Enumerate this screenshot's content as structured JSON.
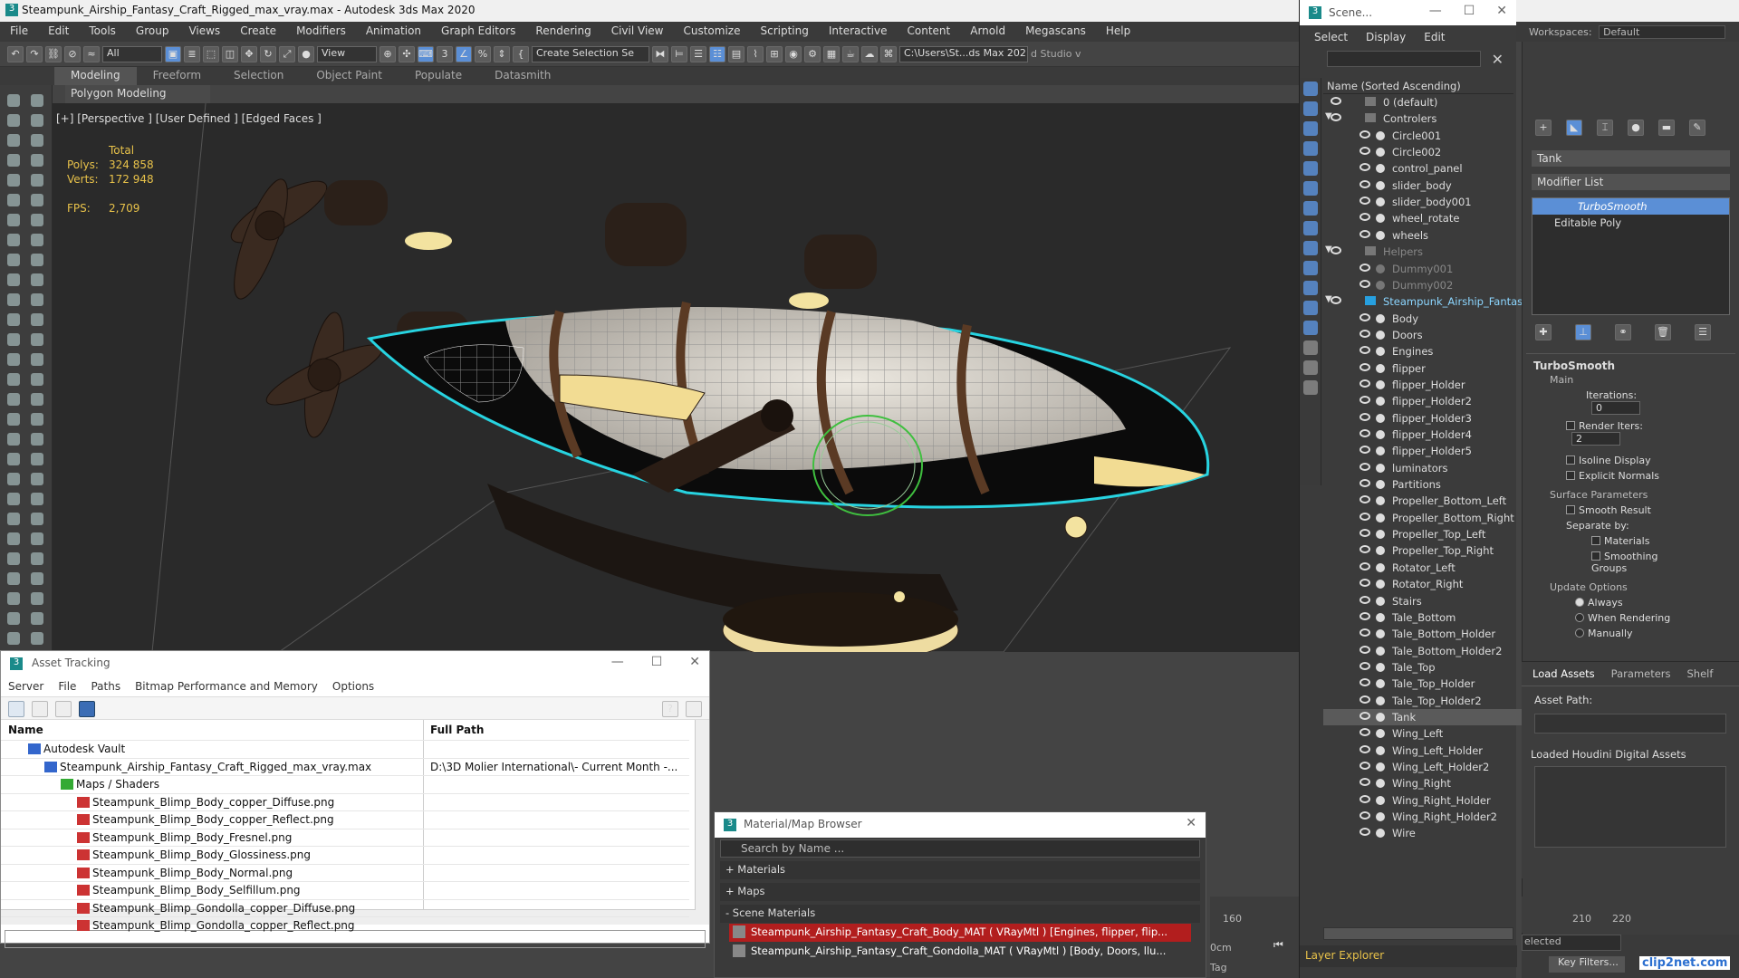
{
  "app": {
    "title": "Steampunk_Airship_Fantasy_Craft_Rigged_max_vray.max - Autodesk 3ds Max 2020",
    "workspace_label": "Workspaces:",
    "workspace_value": "Default"
  },
  "menu": [
    "File",
    "Edit",
    "Tools",
    "Group",
    "Views",
    "Create",
    "Modifiers",
    "Animation",
    "Graph Editors",
    "Rendering",
    "Civil View",
    "Customize",
    "Scripting",
    "Interactive",
    "Content",
    "Arnold",
    "Megascans",
    "Help"
  ],
  "toolbar": {
    "filter": "All",
    "view": "View",
    "selection_set": "Create Selection Se",
    "path": "C:\\Users\\St...ds Max 202",
    "studio": "d Studio v"
  },
  "ribbon": {
    "tabs": [
      "Modeling",
      "Freeform",
      "Selection",
      "Object Paint",
      "Populate",
      "Datasmith"
    ],
    "sub": "Polygon Modeling"
  },
  "viewport": {
    "label": "[+] [Perspective ] [User Defined ] [Edged Faces ]",
    "stats": {
      "total": "Total",
      "polys_label": "Polys:",
      "polys": "324 858",
      "verts_label": "Verts:",
      "verts": "172 948",
      "fps_label": "FPS:",
      "fps": "2,709"
    }
  },
  "scene_explorer": {
    "title": "Scene...",
    "menu": [
      "Select",
      "Display",
      "Edit"
    ],
    "column": "Name (Sorted Ascending)",
    "footer": "Layer Explorer",
    "rows": [
      {
        "name": "0 (default)",
        "level": 0
      },
      {
        "name": "Controlers",
        "level": 0
      },
      {
        "name": "Circle001",
        "level": 1
      },
      {
        "name": "Circle002",
        "level": 1
      },
      {
        "name": "control_panel",
        "level": 1
      },
      {
        "name": "slider_body",
        "level": 1
      },
      {
        "name": "slider_body001",
        "level": 1
      },
      {
        "name": "wheel_rotate",
        "level": 1
      },
      {
        "name": "wheels",
        "level": 1
      },
      {
        "name": "Helpers",
        "level": 0
      },
      {
        "name": "Dummy001",
        "level": 1
      },
      {
        "name": "Dummy002",
        "level": 1
      },
      {
        "name": "Steampunk_Airship_Fantas",
        "level": 0
      },
      {
        "name": "Body",
        "level": 1
      },
      {
        "name": "Doors",
        "level": 1
      },
      {
        "name": "Engines",
        "level": 1
      },
      {
        "name": "flipper",
        "level": 1
      },
      {
        "name": "flipper_Holder",
        "level": 1
      },
      {
        "name": "flipper_Holder2",
        "level": 1
      },
      {
        "name": "flipper_Holder3",
        "level": 1
      },
      {
        "name": "flipper_Holder4",
        "level": 1
      },
      {
        "name": "flipper_Holder5",
        "level": 1
      },
      {
        "name": "luminators",
        "level": 1
      },
      {
        "name": "Partitions",
        "level": 1
      },
      {
        "name": "Propeller_Bottom_Left",
        "level": 1
      },
      {
        "name": "Propeller_Bottom_Right",
        "level": 1
      },
      {
        "name": "Propeller_Top_Left",
        "level": 1
      },
      {
        "name": "Propeller_Top_Right",
        "level": 1
      },
      {
        "name": "Rotator_Left",
        "level": 1
      },
      {
        "name": "Rotator_Right",
        "level": 1
      },
      {
        "name": "Stairs",
        "level": 1
      },
      {
        "name": "Tale_Bottom",
        "level": 1
      },
      {
        "name": "Tale_Bottom_Holder",
        "level": 1
      },
      {
        "name": "Tale_Bottom_Holder2",
        "level": 1
      },
      {
        "name": "Tale_Top",
        "level": 1
      },
      {
        "name": "Tale_Top_Holder",
        "level": 1
      },
      {
        "name": "Tale_Top_Holder2",
        "level": 1
      },
      {
        "name": "Tank",
        "level": 1
      },
      {
        "name": "Wing_Left",
        "level": 1
      },
      {
        "name": "Wing_Left_Holder",
        "level": 1
      },
      {
        "name": "Wing_Left_Holder2",
        "level": 1
      },
      {
        "name": "Wing_Right",
        "level": 1
      },
      {
        "name": "Wing_Right_Holder",
        "level": 1
      },
      {
        "name": "Wing_Right_Holder2",
        "level": 1
      },
      {
        "name": "Wire",
        "level": 1
      }
    ]
  },
  "command_panel": {
    "object_name": "Tank",
    "modifier_list": "Modifier List",
    "stack": [
      "TurboSmooth",
      "Editable Poly"
    ],
    "turbosmooth": {
      "title": "TurboSmooth",
      "main": "Main",
      "iterations_label": "Iterations:",
      "iterations": "0",
      "render_iters_label": "Render Iters:",
      "render_iters": "2",
      "isoline": "Isoline Display",
      "explicit": "Explicit Normals",
      "surface": "Surface Parameters",
      "smooth_result": "Smooth Result",
      "separate": "Separate by:",
      "materials": "Materials",
      "smoothing": "Smoothing Groups",
      "update": "Update Options",
      "always": "Always",
      "when_rendering": "When Rendering",
      "manually": "Manually"
    },
    "tabs": [
      "Load Assets",
      "Parameters",
      "Shelf"
    ],
    "asset_path": "Asset Path:",
    "loaded": "Loaded Houdini Digital Assets"
  },
  "asset_tracking": {
    "title": "Asset Tracking",
    "menu": [
      "Server",
      "File",
      "Paths",
      "Bitmap Performance and Memory",
      "Options"
    ],
    "col_name": "Name",
    "col_path": "Full Path",
    "rows": [
      {
        "name": "Autodesk Vault",
        "path": "",
        "indent": 1
      },
      {
        "name": "Steampunk_Airship_Fantasy_Craft_Rigged_max_vray.max",
        "path": "D:\\3D Molier International\\- Current Month -...",
        "indent": 2
      },
      {
        "name": "Maps / Shaders",
        "path": "",
        "indent": 3
      },
      {
        "name": "Steampunk_Blimp_Body_copper_Diffuse.png",
        "path": "",
        "indent": 4
      },
      {
        "name": "Steampunk_Blimp_Body_copper_Reflect.png",
        "path": "",
        "indent": 4
      },
      {
        "name": "Steampunk_Blimp_Body_Fresnel.png",
        "path": "",
        "indent": 4
      },
      {
        "name": "Steampunk_Blimp_Body_Glossiness.png",
        "path": "",
        "indent": 4
      },
      {
        "name": "Steampunk_Blimp_Body_Normal.png",
        "path": "",
        "indent": 4
      },
      {
        "name": "Steampunk_Blimp_Body_Selfillum.png",
        "path": "",
        "indent": 4
      },
      {
        "name": "Steampunk_Blimp_Gondolla_copper_Diffuse.png",
        "path": "",
        "indent": 4
      },
      {
        "name": "Steampunk_Blimp_Gondolla_copper_Reflect.png",
        "path": "",
        "indent": 4
      }
    ]
  },
  "material_browser": {
    "title": "Material/Map Browser",
    "search": "Search by Name ...",
    "sections": [
      "+ Materials",
      "+ Maps",
      "- Scene Materials"
    ],
    "items": [
      "Steampunk_Airship_Fantasy_Craft_Body_MAT ( VRayMtl ) [Engines, flipper, flip...",
      "Steampunk_Airship_Fantasy_Craft_Gondolla_MAT ( VRayMtl ) [Body, Doors, llu..."
    ]
  },
  "timeline": {
    "t160": "160",
    "t210": "210",
    "t220": "220",
    "frame": "0cm",
    "tag": "Tag",
    "selected": "elected",
    "key_filters": "Key Filters..."
  },
  "watermark": "clip2net.com",
  "colors": {
    "accent": "#5b8fd6",
    "selection": "#3b6db5",
    "stats": "#e8c24a",
    "wire": "#27d3e0"
  }
}
